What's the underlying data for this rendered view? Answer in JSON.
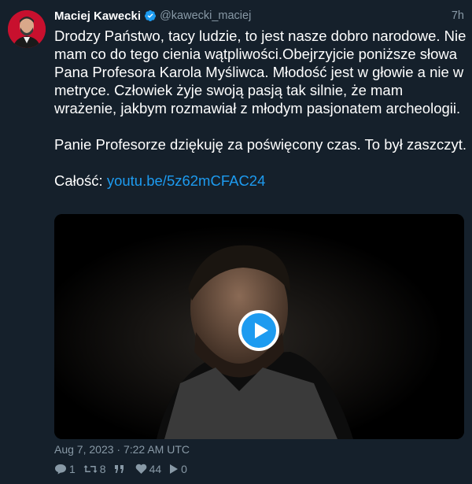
{
  "author": {
    "name": "Maciej Kawecki",
    "handle": "@kawecki_maciej",
    "time_ago": "7h"
  },
  "tweet": {
    "paragraph1": "Drodzy Państwo, tacy ludzie, to jest nasze dobro narodowe. Nie mam co do tego cienia wątpliwości.Obejrzyjcie poniższe słowa Pana Profesora Karola Myśliwca. Młodość jest w głowie a nie w metryce. Człowiek żyje swoją pasją tak silnie, że mam wrażenie, jakbym rozmawiał z młodym pasjonatem archeologii.",
    "paragraph2": "Panie Profesorze dziękuję za poświęcony czas. To był zaszczyt.",
    "link_prefix": "Całość: ",
    "link_text": "youtu.be/5z62mCFAC24"
  },
  "timestamp": "Aug 7, 2023 · 7:22 AM UTC",
  "stats": {
    "replies": "1",
    "retweets": "8",
    "likes": "44",
    "views": "0"
  },
  "colors": {
    "background": "#15202b",
    "text": "#ffffff",
    "muted": "#8899a6",
    "link": "#1d9bf0",
    "verified": "#1d9bf0"
  }
}
